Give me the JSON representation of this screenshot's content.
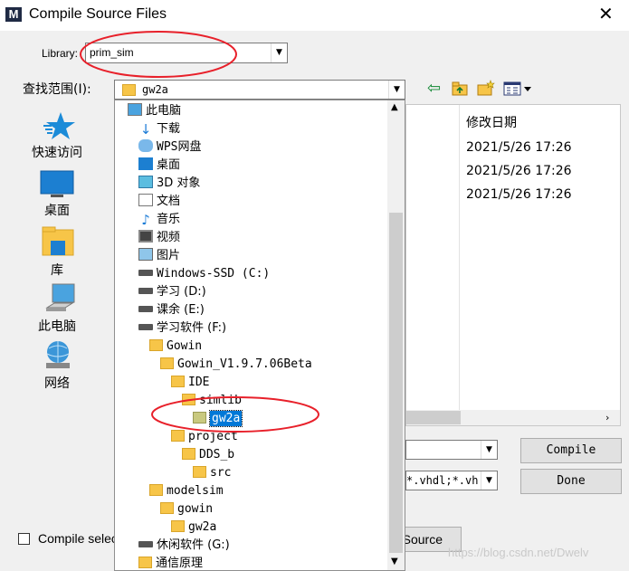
{
  "window": {
    "title": "Compile Source Files",
    "close_glyph": "✕",
    "app_glyph": "M"
  },
  "library": {
    "label": "Library:",
    "value": "prim_sim"
  },
  "lookin": {
    "label": "查找范围(I):",
    "value": "gw2a"
  },
  "places": [
    {
      "name": "quick-access",
      "label": "快速访问",
      "icon": "star-icon"
    },
    {
      "name": "desktop",
      "label": "桌面",
      "icon": "monitor-icon"
    },
    {
      "name": "libraries",
      "label": "库",
      "icon": "library-icon"
    },
    {
      "name": "this-pc",
      "label": "此电脑",
      "icon": "computer-icon"
    },
    {
      "name": "network",
      "label": "网络",
      "icon": "network-icon"
    }
  ],
  "file_list": {
    "column_modified": "修改日期",
    "dates": [
      "2021/5/26 17:26",
      "2021/5/26 17:26",
      "2021/5/26 17:26"
    ]
  },
  "dropdown_items": [
    {
      "label": "此电脑",
      "icon": "computer",
      "indent": 0
    },
    {
      "label": "下载",
      "icon": "download",
      "indent": 1
    },
    {
      "label": "WPS网盘",
      "icon": "cloud",
      "indent": 1
    },
    {
      "label": "桌面",
      "icon": "desktop",
      "indent": 1
    },
    {
      "label": "3D 对象",
      "icon": "cube",
      "indent": 1
    },
    {
      "label": "文档",
      "icon": "document",
      "indent": 1
    },
    {
      "label": "音乐",
      "icon": "music",
      "indent": 1
    },
    {
      "label": "视频",
      "icon": "video",
      "indent": 1
    },
    {
      "label": "图片",
      "icon": "picture",
      "indent": 1
    },
    {
      "label": "Windows-SSD (C:)",
      "icon": "drive",
      "indent": 1
    },
    {
      "label": "学习 (D:)",
      "icon": "drive",
      "indent": 1
    },
    {
      "label": "课余 (E:)",
      "icon": "drive",
      "indent": 1
    },
    {
      "label": "学习软件 (F:)",
      "icon": "drive",
      "indent": 1
    },
    {
      "label": "Gowin",
      "icon": "folder",
      "indent": 2
    },
    {
      "label": "Gowin_V1.9.7.06Beta",
      "icon": "folder",
      "indent": 3
    },
    {
      "label": "IDE",
      "icon": "folder",
      "indent": 4
    },
    {
      "label": "simlib",
      "icon": "folder",
      "indent": 5
    },
    {
      "label": "gw2a",
      "icon": "folder-open",
      "indent": 6,
      "selected": true
    },
    {
      "label": "project",
      "icon": "folder",
      "indent": 4
    },
    {
      "label": "DDS_b",
      "icon": "folder",
      "indent": 5
    },
    {
      "label": "src",
      "icon": "folder",
      "indent": 6
    },
    {
      "label": "modelsim",
      "icon": "folder",
      "indent": 2
    },
    {
      "label": "gowin",
      "icon": "folder",
      "indent": 3
    },
    {
      "label": "gw2a",
      "icon": "folder",
      "indent": 4
    },
    {
      "label": "休闲软件 (G:)",
      "icon": "drive",
      "indent": 1
    },
    {
      "label": "通信原理",
      "icon": "folder",
      "indent": 1
    }
  ],
  "file_type": {
    "value": "*.vhdl;*.vh"
  },
  "buttons": {
    "compile": "Compile",
    "done": "Done",
    "source": "Source"
  },
  "compile_selected": {
    "label": "Compile selec"
  },
  "watermark": "https://blog.csdn.net/Dwelv",
  "colors": {
    "selection": "#0078d7",
    "annotation": "#e8202a",
    "folder": "#f7c548"
  }
}
